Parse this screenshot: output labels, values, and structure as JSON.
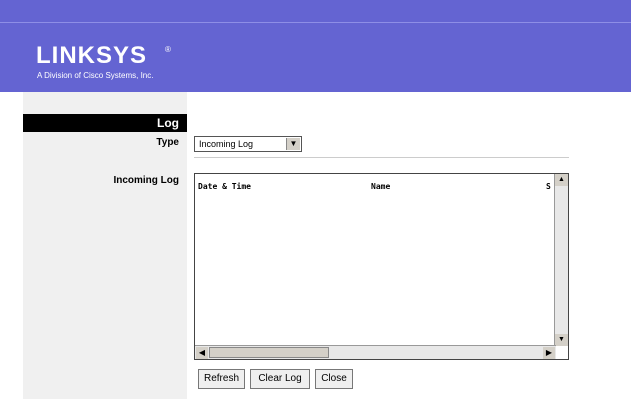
{
  "branding": {
    "logo_text": "LINKSYS",
    "registered": "®",
    "subtitle": "A Division of Cisco Systems, Inc."
  },
  "section": {
    "title": "Log"
  },
  "type_field": {
    "label": "Type",
    "selected": "Incoming Log",
    "arrow": "▼"
  },
  "log_field": {
    "label": "Incoming Log",
    "columns": [
      "Date & Time",
      "Name",
      "S"
    ]
  },
  "buttons": {
    "refresh": "Refresh",
    "clear": "Clear Log",
    "close": "Close"
  },
  "scroll": {
    "up": "▲",
    "down": "▼",
    "left": "◀",
    "right": "▶"
  },
  "colors": {
    "banner": "#6464d2",
    "section_bar": "#000000",
    "left_column": "#f0f0f0"
  }
}
